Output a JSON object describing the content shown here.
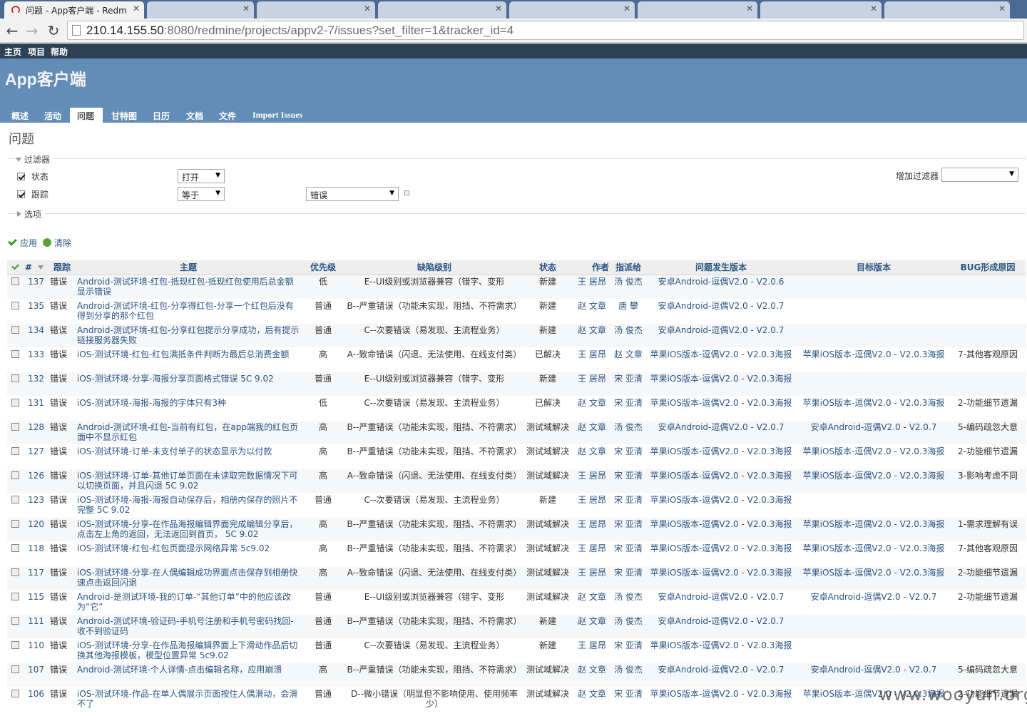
{
  "browser": {
    "tabs": [
      {
        "title": "问题 - App客户端 - Redm",
        "active": true
      },
      {
        "title": "",
        "active": false
      },
      {
        "title": "",
        "active": false
      },
      {
        "title": "",
        "active": false
      },
      {
        "title": "",
        "active": false
      },
      {
        "title": "",
        "active": false
      },
      {
        "title": "",
        "active": false
      }
    ],
    "url_host": "210.14.155.50",
    "url_rest": ":8080/redmine/projects/appv2-7/issues?set_filter=1&tracker_id=4"
  },
  "top_menu": [
    "主页",
    "项目",
    "帮助"
  ],
  "project_title": "App客户端",
  "main_menu": [
    "概述",
    "活动",
    "问题",
    "甘特图",
    "日历",
    "文档",
    "文件",
    "Import Issues"
  ],
  "main_menu_selected": "问题",
  "page_title": "问题",
  "filters": {
    "legend": "过滤器",
    "status_label": "状态",
    "status_operator": "打开",
    "tracker_label": "跟踪",
    "tracker_operator": "等于",
    "tracker_value": "错误",
    "add_filter_label": "增加过滤器",
    "add_filter_value": ""
  },
  "options_legend": "选项",
  "actions": {
    "apply": "应用",
    "clear": "清除"
  },
  "columns": [
    "#",
    "跟踪",
    "主题",
    "优先级",
    "缺陷级别",
    "状态",
    "作者",
    "指派给",
    "问题发生版本",
    "目标版本",
    "BUG形成原因"
  ],
  "issues": [
    {
      "id": "137",
      "tracker": "错误",
      "subject": "Android-测试环境-红包-抵现红包-抵现红包使用后总金额显示错误",
      "priority": "低",
      "severity": "E--UI级别或浏览器兼容（错字、变形",
      "status": "新建",
      "author": "王 居昂",
      "assignee": "汤 俊杰",
      "found_version": "安卓Android-逗偶V2.0 - V2.0.6",
      "target_version": "",
      "cause": ""
    },
    {
      "id": "135",
      "tracker": "错误",
      "subject": "Android-测试环境-红包-分享得红包-分享一个红包后没有得到分享的那个红包",
      "priority": "普通",
      "severity": "B--严重错误（功能未实现，阻挡、不符需求）",
      "status": "新建",
      "author": "赵 文章",
      "assignee": "唐 攀",
      "found_version": "安卓Android-逗偶V2.0 - V2.0.7",
      "target_version": "",
      "cause": ""
    },
    {
      "id": "134",
      "tracker": "错误",
      "subject": "Android-测试环境-红包-分享红包提示分享成功，后有提示链接服务器失败",
      "priority": "普通",
      "severity": "C--次要错误（易发现、主流程业务）",
      "status": "新建",
      "author": "赵 文章",
      "assignee": "汤 俊杰",
      "found_version": "安卓Android-逗偶V2.0 - V2.0.7",
      "target_version": "",
      "cause": ""
    },
    {
      "id": "133",
      "tracker": "错误",
      "subject": "iOS-测试环境-红包-红包满抵条件判断为最后总消费金额",
      "priority": "高",
      "severity": "A--致命错误（闪退、无法使用、在线支付类）",
      "status": "已解决",
      "author": "王 居昂",
      "assignee": "赵 文章",
      "found_version": "苹果iOS版本-逗偶V2.0 - V2.0.3海报",
      "target_version": "苹果iOS版本-逗偶V2.0 - V2.0.3海报",
      "cause": "7-其他客观原因"
    },
    {
      "id": "132",
      "tracker": "错误",
      "subject": "iOS-测试环境-分享-海报分享页面格式错误 5C 9.02",
      "priority": "普通",
      "severity": "E--UI级别或浏览器兼容（错字、变形",
      "status": "新建",
      "author": "王 居昂",
      "assignee": "宋 亚清",
      "found_version": "苹果iOS版本-逗偶V2.0 - V2.0.3海报",
      "target_version": "",
      "cause": ""
    },
    {
      "id": "131",
      "tracker": "错误",
      "subject": "iOS-测试环境-海报-海报的字体只有3种",
      "priority": "低",
      "severity": "C--次要错误（易发现、主流程业务）",
      "status": "已解决",
      "author": "赵 文章",
      "assignee": "宋 亚清",
      "found_version": "苹果iOS版本-逗偶V2.0 - V2.0.3海报",
      "target_version": "苹果iOS版本-逗偶V2.0 - V2.0.3海报",
      "cause": "2-功能细节遗漏"
    },
    {
      "id": "128",
      "tracker": "错误",
      "subject": "Android-测试环境-红包-当前有红包，在app端我的红包页面中不显示红包",
      "priority": "高",
      "severity": "B--严重错误（功能未实现，阻挡、不符需求）",
      "status": "测试域解决",
      "author": "赵 文章",
      "assignee": "汤 俊杰",
      "found_version": "安卓Android-逗偶V2.0 - V2.0.7",
      "target_version": "安卓Android-逗偶V2.0 - V2.0.7",
      "cause": "5-编码疏忽大意"
    },
    {
      "id": "127",
      "tracker": "错误",
      "subject": "iOS-测试环境-订单-未支付单子的状态显示为以付款",
      "priority": "高",
      "severity": "B--严重错误（功能未实现，阻挡、不符需求）",
      "status": "测试域解决",
      "author": "赵 文章",
      "assignee": "宋 亚清",
      "found_version": "苹果iOS版本-逗偶V2.0 - V2.0.3海报",
      "target_version": "苹果iOS版本-逗偶V2.0 - V2.0.3海报",
      "cause": "2-功能细节遗漏"
    },
    {
      "id": "126",
      "tracker": "错误",
      "subject": "iOS-测试环境-订单-其他订单页面在未读取完数据情况下可以切换页面，并且闪退 5C 9.02",
      "priority": "高",
      "severity": "A--致命错误（闪退、无法使用、在线支付类）",
      "status": "测试域解决",
      "author": "王 居昂",
      "assignee": "宋 亚清",
      "found_version": "苹果iOS版本-逗偶V2.0 - V2.0.3海报",
      "target_version": "苹果iOS版本-逗偶V2.0 - V2.0.3海报",
      "cause": "3-影响考虑不同"
    },
    {
      "id": "123",
      "tracker": "错误",
      "subject": "iOS-测试环境-海报-海报自动保存后，相册内保存的照片不完整 5C 9.02",
      "priority": "普通",
      "severity": "C--次要错误（易发现、主流程业务）",
      "status": "新建",
      "author": "王 居昂",
      "assignee": "宋 亚清",
      "found_version": "苹果iOS版本-逗偶V2.0 - V2.0.3海报",
      "target_version": "",
      "cause": ""
    },
    {
      "id": "120",
      "tracker": "错误",
      "subject": "iOS-测试环境-分享-在作品海报编辑界面完成编辑分享后，点击左上角的返回，无法返回到首页， 5C 9.02",
      "priority": "高",
      "severity": "B--严重错误（功能未实现，阻挡、不符需求）",
      "status": "测试域解决",
      "author": "王 居昂",
      "assignee": "宋 亚清",
      "found_version": "苹果iOS版本-逗偶V2.0 - V2.0.3海报",
      "target_version": "苹果iOS版本-逗偶V2.0 - V2.0.3海报",
      "cause": "1-需求理解有误"
    },
    {
      "id": "118",
      "tracker": "错误",
      "subject": "iOS-测试环境-红包-红包页面提示网络异常 5c9.02",
      "priority": "高",
      "severity": "B--严重错误（功能未实现，阻挡、不符需求）",
      "status": "测试域解决",
      "author": "王 居昂",
      "assignee": "宋 亚清",
      "found_version": "苹果iOS版本-逗偶V2.0 - V2.0.3海报",
      "target_version": "苹果iOS版本-逗偶V2.0 - V2.0.3海报",
      "cause": "7-其他客观原因"
    },
    {
      "id": "117",
      "tracker": "错误",
      "subject": "iOS-测试环境-分享-在人偶编辑成功界面点击保存到相册快速点击返回闪退",
      "priority": "高",
      "severity": "A--致命错误（闪退、无法使用、在线支付类）",
      "status": "测试域解决",
      "author": "王 居昂",
      "assignee": "宋 亚清",
      "found_version": "苹果iOS版本-逗偶V2.0 - V2.0.3海报",
      "target_version": "苹果iOS版本-逗偶V2.0 - V2.0.3海报",
      "cause": "2-功能细节遗漏"
    },
    {
      "id": "115",
      "tracker": "错误",
      "subject": "Android-是测试环境-我的订单-“其他订单”中的他应该改为“它”",
      "priority": "普通",
      "severity": "E--UI级别或浏览器兼容（错字、变形",
      "status": "测试域解决",
      "author": "赵 文章",
      "assignee": "汤 俊杰",
      "found_version": "安卓Android-逗偶V2.0 - V2.0.7",
      "target_version": "安卓Android-逗偶V2.0 - V2.0.7",
      "cause": "2-功能细节遗漏"
    },
    {
      "id": "111",
      "tracker": "错误",
      "subject": "Android-测试环境-验证码-手机号注册和手机号密码找回-收不到验证码",
      "priority": "普通",
      "severity": "B--严重错误（功能未实现，阻挡、不符需求）",
      "status": "新建",
      "author": "赵 文章",
      "assignee": "汤 俊杰",
      "found_version": "安卓Android-逗偶V2.0 - V2.0.7",
      "target_version": "",
      "cause": ""
    },
    {
      "id": "110",
      "tracker": "错误",
      "subject": "iOS-测试环境-分享-在作品海报编辑界面上下滑动作品后切换其他海报模板，模型位置异常 5c9.02",
      "priority": "普通",
      "severity": "C--次要错误（易发现、主流程业务）",
      "status": "新建",
      "author": "王 居昂",
      "assignee": "宋 亚清",
      "found_version": "苹果iOS版本-逗偶V2.0 - V2.0.3海报",
      "target_version": "",
      "cause": ""
    },
    {
      "id": "107",
      "tracker": "错误",
      "subject": "Android-测试环境-个人详情-点击编辑名称，应用崩溃",
      "priority": "高",
      "severity": "B--严重错误（功能未实现，阻挡、不符需求）",
      "status": "测试域解决",
      "author": "赵 文章",
      "assignee": "汤 俊杰",
      "found_version": "安卓Android-逗偶V2.0 - V2.0.7",
      "target_version": "安卓Android-逗偶V2.0 - V2.0.7",
      "cause": "5-编码疏忽大意"
    },
    {
      "id": "106",
      "tracker": "错误",
      "subject": "iOS-测试环境-作品-在单人偶展示页面按住人偶滑动，会滑不了",
      "priority": "普通",
      "severity": "D--微小错误（明显但不影响使用、使用频率少）",
      "status": "测试域解决",
      "author": "赵 文章",
      "assignee": "宋 亚清",
      "found_version": "苹果iOS版本-逗偶V2.0 - V2.0.3海报",
      "target_version": "苹果iOS版本-逗偶V2.0 - V2.0.3海报",
      "cause": "2-功能细节遗漏"
    }
  ],
  "watermark": "www.wooyun.org"
}
